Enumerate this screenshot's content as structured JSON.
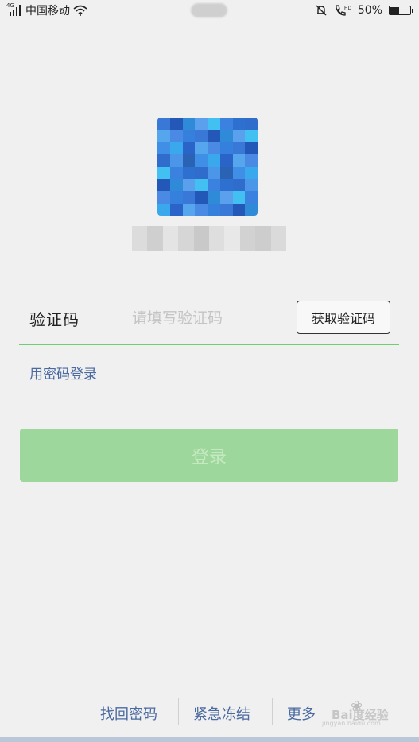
{
  "status_bar": {
    "network_type": "4G",
    "carrier": "中国移动",
    "battery_percent": "50%",
    "icons": [
      "signal-icon",
      "wifi-icon",
      "mute-bell-icon",
      "hd-call-icon",
      "battery-icon"
    ]
  },
  "login": {
    "code_label": "验证码",
    "code_placeholder": "请填写验证码",
    "get_code_button": "获取验证码",
    "password_login_link": "用密码登录",
    "login_button": "登录"
  },
  "footer": {
    "links": [
      "找回密码",
      "紧急冻结",
      "更多"
    ]
  },
  "watermark": {
    "brand": "Bai度经验",
    "url": "jingyan.baidu.com"
  },
  "colors": {
    "background": "#f0f0f0",
    "accent_green": "#6dd06d",
    "login_button_disabled": "#9ed79b",
    "link_blue": "#4a6aa0"
  }
}
